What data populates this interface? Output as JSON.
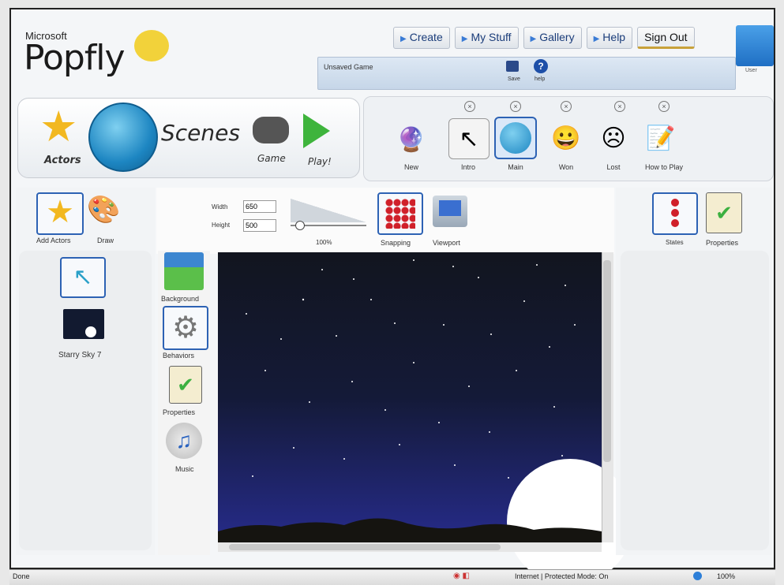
{
  "brand": {
    "small": "Microsoft",
    "big": "Popfly"
  },
  "nav": {
    "create": "Create",
    "my_stuff": "My Stuff",
    "gallery": "Gallery",
    "help": "Help",
    "sign_out": "Sign Out"
  },
  "user": {
    "label": "User"
  },
  "game": {
    "title": "Unsaved Game",
    "save_label": "Save",
    "help_label": "help"
  },
  "toolbar": {
    "actors": "Actors",
    "scenes": "Scenes",
    "game": "Game",
    "play": "Play!"
  },
  "scenes": [
    {
      "label": "New"
    },
    {
      "label": "Intro"
    },
    {
      "label": "Main"
    },
    {
      "label": "Won"
    },
    {
      "label": "Lost"
    },
    {
      "label": "How to Play"
    }
  ],
  "left": {
    "add_actors": "Add Actors",
    "draw": "Draw",
    "actor_name": "Starry Sky 7"
  },
  "canvas": {
    "width_label": "Width",
    "width": "650",
    "height_label": "Height",
    "height": "500",
    "zoom": "100%",
    "snapping": "Snapping",
    "viewport": "Viewport"
  },
  "sidetools": {
    "background": "Background",
    "behaviors": "Behaviors",
    "properties": "Properties",
    "music": "Music"
  },
  "right": {
    "states": "States",
    "properties": "Properties"
  },
  "status": {
    "done": "Done",
    "zone": "Internet | Protected Mode: On",
    "zoom": "100%"
  },
  "colors": {
    "accent": "#2d62b4",
    "play": "#3eb43c",
    "sky_top": "#12151f",
    "sky_bottom": "#262b8a"
  }
}
